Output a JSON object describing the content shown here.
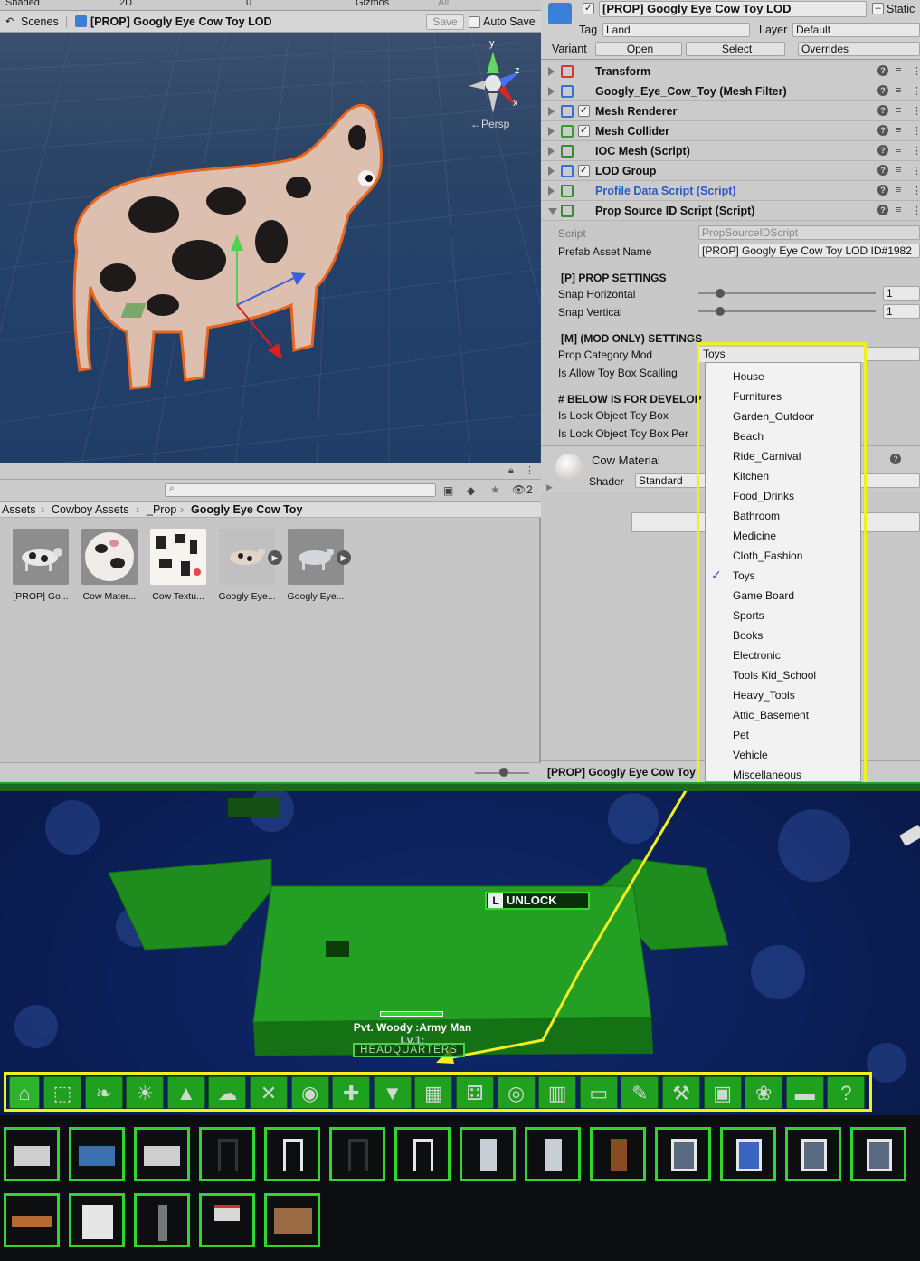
{
  "scene_toolbar": {
    "shaded": "Shaded",
    "mode_2d": "2D",
    "gizmos": "Gizmos",
    "search": "All",
    "count": "0"
  },
  "scene_tab": {
    "scenes": "Scenes",
    "prefab": "[PROP] Googly Eye Cow Toy LOD",
    "save": "Save",
    "auto_save": "Auto Save"
  },
  "viewport": {
    "persp": "←Persp",
    "axis_y": "y",
    "axis_z": "z",
    "axis_x": "x"
  },
  "project": {
    "hidden_count": "2",
    "breadcrumb": [
      "Assets",
      "Cowboy Assets",
      "_Prop",
      "Googly Eye Cow Toy"
    ],
    "assets": [
      "[PROP] Go...",
      "Cow Mater...",
      "Cow Textu...",
      "Googly Eye...",
      "Googly Eye..."
    ]
  },
  "inspector": {
    "name": "[PROP] Googly Eye Cow Toy LOD",
    "static": "Static",
    "tag_label": "Tag",
    "tag": "Land",
    "layer_label": "Layer",
    "layer": "Default",
    "variant_label": "Variant",
    "open": "Open",
    "select": "Select",
    "overrides": "Overrides",
    "components": [
      {
        "name": "Transform",
        "check": false,
        "color": "#d33",
        "link": false
      },
      {
        "name": "Googly_Eye_Cow_Toy (Mesh Filter)",
        "check": false,
        "color": "#3a6fd0",
        "link": false
      },
      {
        "name": "Mesh Renderer",
        "check": true,
        "color": "#3a6fd0",
        "link": false
      },
      {
        "name": "Mesh Collider",
        "check": true,
        "color": "#3a9a3a",
        "link": false
      },
      {
        "name": "IOC Mesh (Script)",
        "check": false,
        "color": "#3a8a3a",
        "link": false
      },
      {
        "name": "LOD Group",
        "check": true,
        "color": "#3a6fd0",
        "link": false
      },
      {
        "name": "Profile Data Script (Script)",
        "check": false,
        "color": "#3a8a3a",
        "link": true
      },
      {
        "name": "Prop Source ID Script (Script)",
        "check": false,
        "color": "#3a8a3a",
        "link": false
      }
    ],
    "script_label": "Script",
    "script_value": "PropSourceIDScript",
    "prefab_asset_label": "Prefab Asset Name",
    "prefab_asset_value": "[PROP] Googly Eye Cow Toy LOD ID#1982",
    "prop_settings": "[P] PROP SETTINGS",
    "snap_h_label": "Snap Horizontal",
    "snap_h": "1",
    "snap_v_label": "Snap Vertical",
    "snap_v": "1",
    "mod_settings": "[M] (MOD ONLY) SETTINGS",
    "prop_cat_label": "Prop Category Mod",
    "allow_toy_label": "Is Allow Toy Box Scalling",
    "below_label": "# BELOW IS FOR DEVELOP",
    "lock_obj_label": "Is Lock Object Toy Box",
    "lock_obj_per_label": "Is Lock Object Toy Box Per",
    "material": "Cow Material",
    "shader_label": "Shader",
    "shader": "Standard",
    "footer": "[PROP] Googly Eye Cow Toy"
  },
  "dropdown": {
    "selected": "Toys",
    "options": [
      "House",
      "Furnitures",
      "Garden_Outdoor",
      "Beach",
      "Ride_Carnival",
      "Kitchen",
      "Food_Drinks",
      "Bathroom",
      "Medicine",
      "Cloth_Fashion",
      "Toys",
      "Game Board",
      "Sports",
      "Books",
      "Electronic",
      "Tools Kid_School",
      "Heavy_Tools",
      "Attic_Basement",
      "Pet",
      "Vehicle",
      "Miscellaneous"
    ],
    "checked_index": 10
  },
  "game": {
    "unlock_key": "L",
    "unlock": "UNLOCK",
    "npc_name": "Pvt. Woody :Army Man",
    "npc_level": "Lv.1:",
    "headquarters": "HEADQUARTERS",
    "toolbar_icons": [
      "house-icon",
      "bed-icon",
      "leaf-icon",
      "sunset-icon",
      "tent-icon",
      "chef-hat-icon",
      "fork-knife-icon",
      "drop-icon",
      "cross-icon",
      "shirt-icon",
      "toy-blocks-icon",
      "dice-icon",
      "ball-icon",
      "book-icon",
      "tv-icon",
      "pencil-icon",
      "tools-icon",
      "box-icon",
      "paw-icon",
      "car-icon",
      "question-icon"
    ],
    "colors": {
      "accent": "#2fd62f",
      "highlight": "#f2ee22"
    }
  }
}
